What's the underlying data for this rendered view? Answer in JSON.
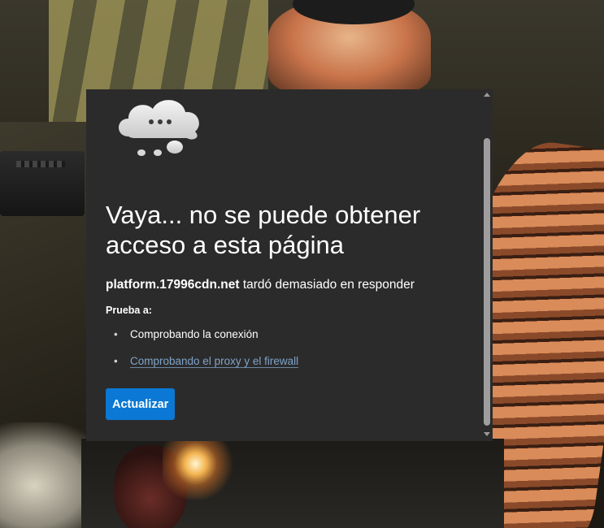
{
  "error_page": {
    "icon": "cloud-thinking-icon",
    "title": "Vaya... no se puede obtener acceso a esta página",
    "host": "platform.17996cdn.net",
    "message_suffix": " tardó demasiado en responder",
    "try_label": "Prueba a:",
    "suggestions": [
      {
        "text": "Comprobando la conexión",
        "is_link": false
      },
      {
        "text": "Comprobando el proxy y el firewall",
        "is_link": true
      }
    ],
    "refresh_label": "Actualizar"
  },
  "colors": {
    "panel_background": "#2b2b2b",
    "button_blue": "#0a78d4",
    "link": "#7fa3c9",
    "text": "#ffffff"
  }
}
